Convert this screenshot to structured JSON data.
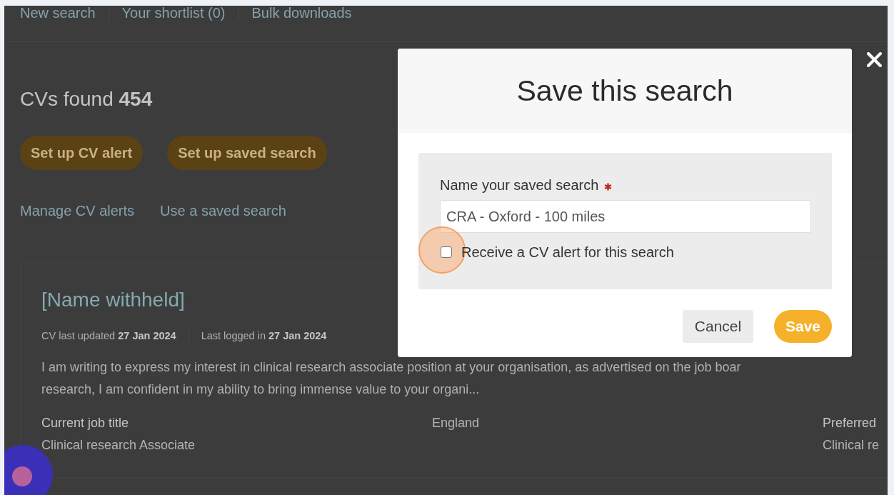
{
  "nav": [
    {
      "label": "New search"
    },
    {
      "label": "Your shortlist (0)"
    },
    {
      "label": "Bulk downloads"
    }
  ],
  "heading": "CVs found **454**",
  "actions": [
    "Set up CV alert",
    "Set up saved search"
  ],
  "links": [
    "Manage CV alerts",
    "Use a saved search"
  ],
  "candidate": {
    "name": "[Name withheld]",
    "meta": [
      "CV last updated **27 Jan 2024**",
      "Last logged in **27 Jan 2024**"
    ],
    "summary_lines": [
      "I am writing to express my interest in clinical research associate position at your organisation, as advertised on the job boar",
      "research, I am confident in my ability to bring immense value to your organi..."
    ],
    "fields": [
      {
        "label": "Current job title",
        "value": "Clinical research Associate"
      },
      {
        "value": "England"
      },
      {
        "label": "Preferred",
        "value": "Clinical re"
      }
    ]
  },
  "dialog": {
    "title": "Save this search",
    "name_field": {
      "label": "Name your saved search",
      "required": true,
      "value": "CRA - Oxford - 100 miles"
    },
    "alert_option": {
      "label": "Receive a CV alert for this search",
      "checked": false
    },
    "buttons": [
      {
        "label": "Cancel",
        "kind": "secondary"
      },
      {
        "label": "Save",
        "kind": "primary"
      }
    ]
  }
}
